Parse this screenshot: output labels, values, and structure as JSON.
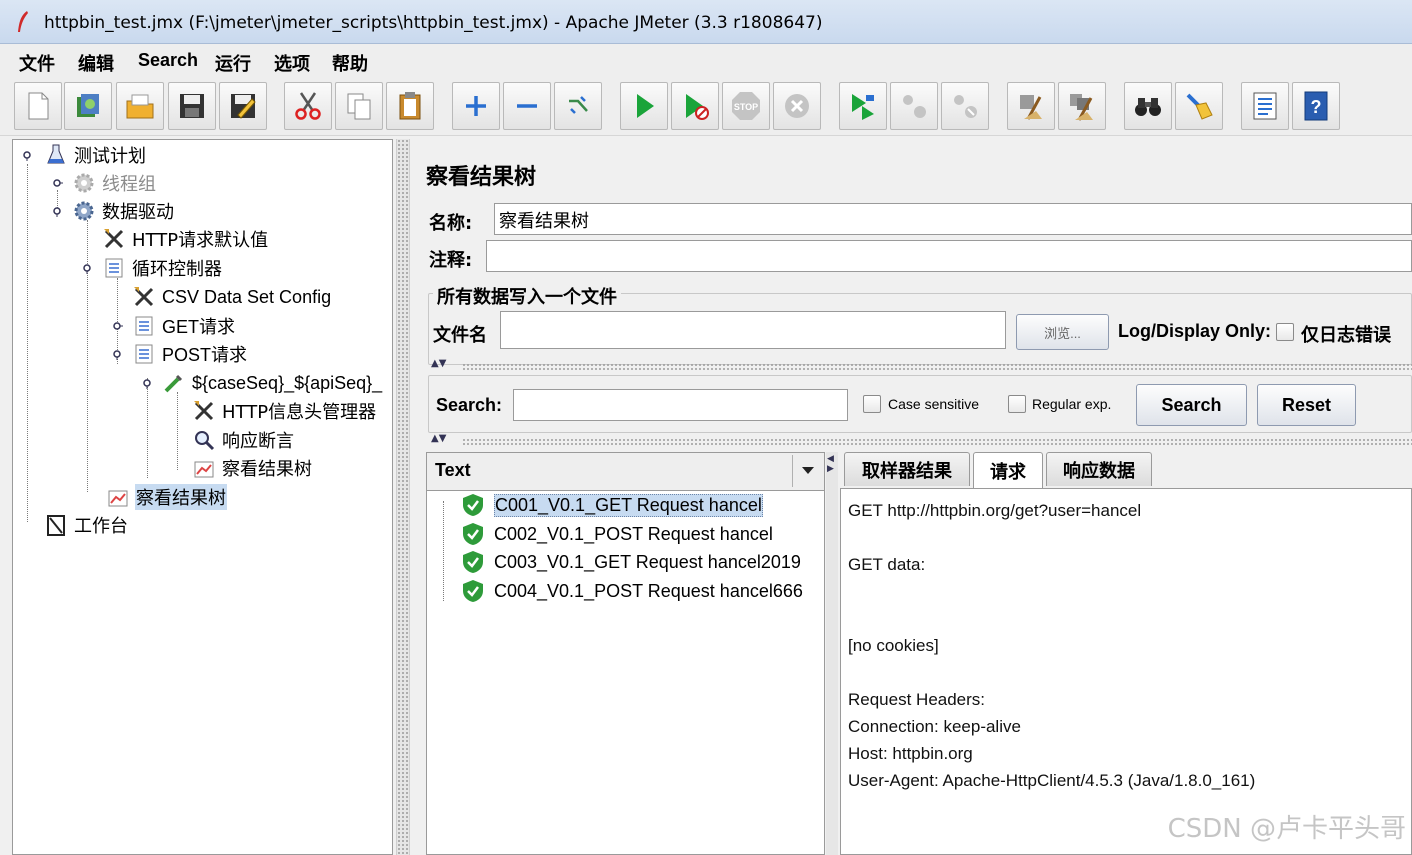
{
  "window": {
    "title": "httpbin_test.jmx (F:\\jmeter\\jmeter_scripts\\httpbin_test.jmx) - Apache JMeter (3.3 r1808647)"
  },
  "menu": {
    "items": [
      "文件",
      "编辑",
      "Search",
      "运行",
      "选项",
      "帮助"
    ]
  },
  "toolbar": {
    "icons": [
      "new-icon",
      "templates-icon",
      "open-icon",
      "save-icon",
      "save-as-icon",
      "cut-icon",
      "copy-icon",
      "paste-icon",
      "expand-icon",
      "collapse-icon",
      "toggle-icon",
      "start-icon",
      "start-no-pause-icon",
      "stop-icon",
      "shutdown-icon",
      "remote-start-icon",
      "remote-stop-icon",
      "remote-shutdown-icon",
      "clear-icon",
      "clear-all-icon",
      "search-icon",
      "reset-search-icon",
      "function-helper-icon",
      "help-icon"
    ]
  },
  "tree": {
    "items": [
      {
        "label": "测试计划"
      },
      {
        "label": "线程组"
      },
      {
        "label": "数据驱动"
      },
      {
        "label": "HTTP请求默认值"
      },
      {
        "label": "循环控制器"
      },
      {
        "label": "CSV Data Set Config"
      },
      {
        "label": "GET请求"
      },
      {
        "label": "POST请求"
      },
      {
        "label": "${caseSeq}_${apiSeq}_"
      },
      {
        "label": "HTTP信息头管理器"
      },
      {
        "label": "响应断言"
      },
      {
        "label": "察看结果树"
      },
      {
        "label": "察看结果树"
      },
      {
        "label": "工作台"
      }
    ]
  },
  "panel": {
    "title": "察看结果树",
    "name_label": "名称:",
    "name_value": "察看结果树",
    "comment_label": "注释:",
    "comment_value": "",
    "file_group_title": "所有数据写入一个文件",
    "filename_label": "文件名",
    "filename_value": "",
    "browse_button": "浏览...",
    "log_display_label": "Log/Display Only:",
    "errors_only_label": "仅日志错误"
  },
  "search": {
    "label": "Search:",
    "value": "",
    "case_sensitive": "Case sensitive",
    "regular_exp": "Regular exp.",
    "search_button": "Search",
    "reset_button": "Reset"
  },
  "results": {
    "renderer": "Text",
    "items": [
      {
        "label": "C001_V0.1_GET Request hancel",
        "status": "success"
      },
      {
        "label": "C002_V0.1_POST Request hancel",
        "status": "success"
      },
      {
        "label": "C003_V0.1_GET Request hancel2019",
        "status": "success"
      },
      {
        "label": "C004_V0.1_POST Request hancel666",
        "status": "success"
      }
    ]
  },
  "tabs": {
    "items": [
      "取样器结果",
      "请求",
      "响应数据"
    ],
    "active": "请求"
  },
  "detail": {
    "lines": [
      "GET http://httpbin.org/get?user=hancel",
      "",
      "GET data:",
      "",
      "",
      "[no cookies]",
      "",
      "Request Headers:",
      "Connection: keep-alive",
      "Host: httpbin.org",
      "User-Agent: Apache-HttpClient/4.5.3 (Java/1.8.0_161)"
    ]
  },
  "watermark": "CSDN @卢卡平头哥",
  "colors": {
    "selection": "#c7dbf1",
    "success": "#2e9b3a",
    "accent": "#3a6ea5"
  }
}
